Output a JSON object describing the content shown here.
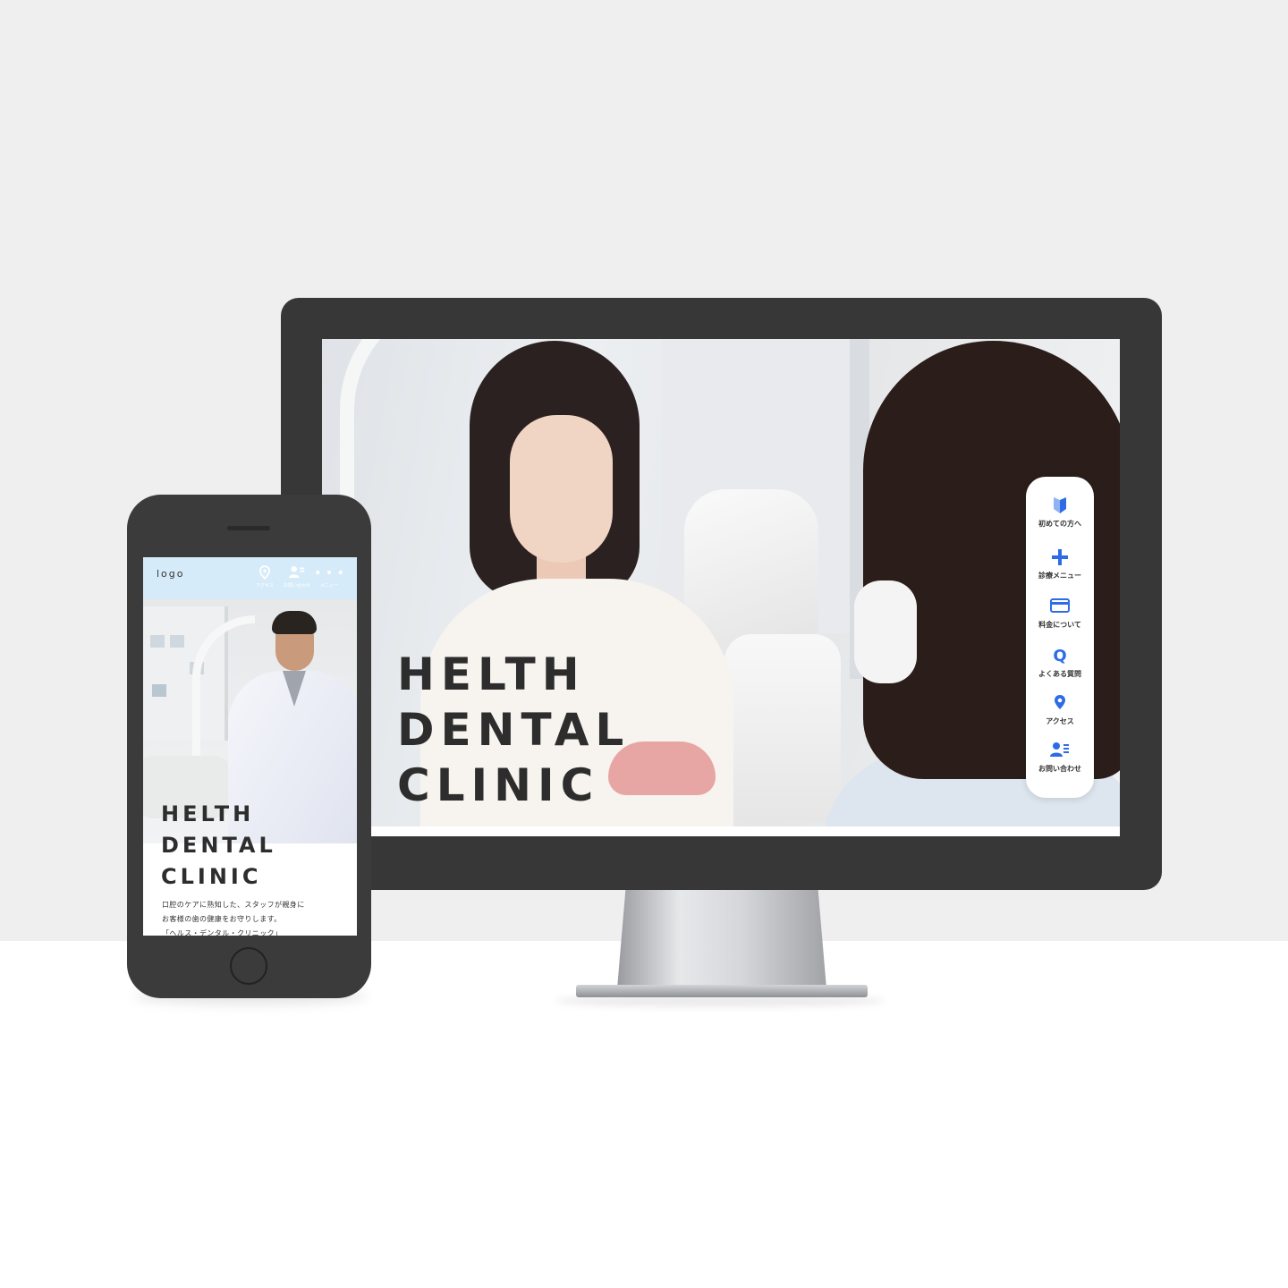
{
  "desktop": {
    "hero_title_lines": [
      "HELTH",
      "DENTAL",
      "CLINIC"
    ],
    "side_nav": [
      {
        "icon": "beginner-mark-icon",
        "label": "初めての方へ"
      },
      {
        "icon": "plus-icon",
        "label": "診療メニュー"
      },
      {
        "icon": "card-icon",
        "label": "料金について"
      },
      {
        "icon": "question-icon",
        "label": "よくある質問"
      },
      {
        "icon": "map-pin-icon",
        "label": "アクセス"
      },
      {
        "icon": "contact-icon",
        "label": "お問い合わせ"
      }
    ],
    "accent_color": "#2e6be6"
  },
  "mobile": {
    "logo": "logo",
    "nav": [
      {
        "icon": "map-pin-icon",
        "label": "アクセス"
      },
      {
        "icon": "contact-icon",
        "label": "お問い合わせ"
      },
      {
        "icon": "more-dots-icon",
        "label": "メニュー"
      }
    ],
    "hero_title_lines": [
      "HELTH",
      "DENTAL",
      "CLINIC"
    ],
    "description_lines": [
      "口腔のケアに熟知した、スタッフが親身に",
      "お客様の歯の健康をお守りします。",
      "「ヘルス・デンタル・クリニック」"
    ],
    "header_color": "#d6ebf9"
  }
}
